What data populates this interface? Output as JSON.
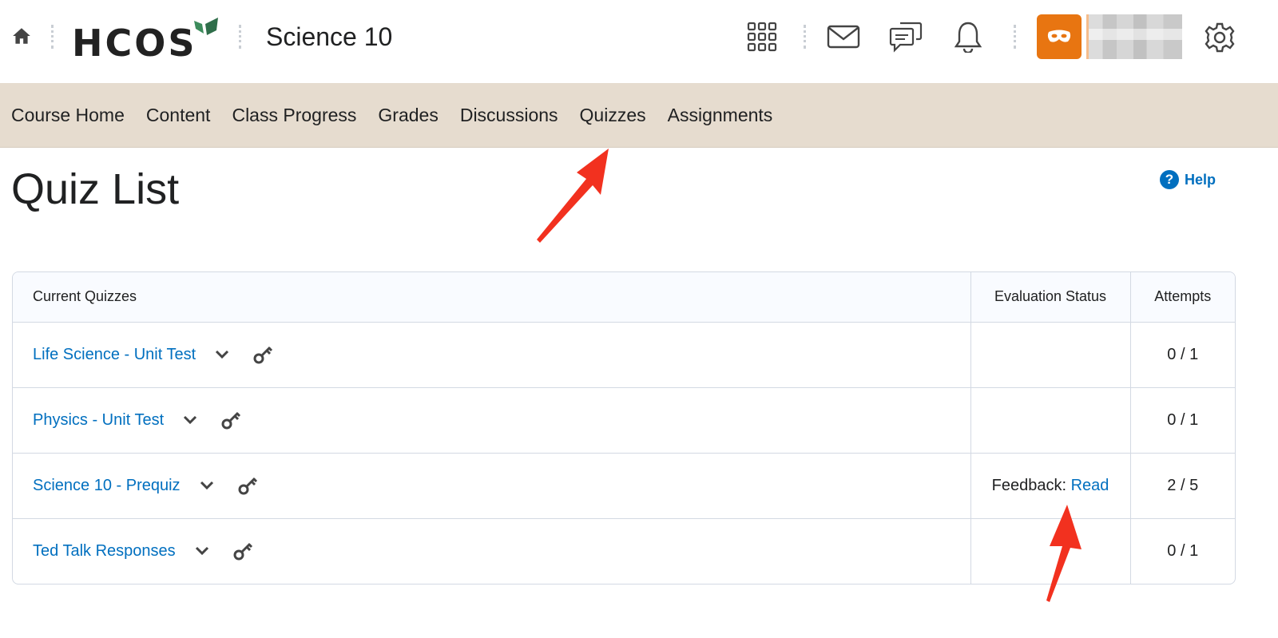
{
  "header": {
    "logo_text": "HCOS",
    "course_title": "Science 10",
    "icons": {
      "home": "home-icon",
      "apps": "grid-icon",
      "mail": "mail-icon",
      "chat": "chat-icon",
      "notifications": "bell-icon",
      "avatar": "mask-icon",
      "settings": "gear-icon"
    },
    "avatar_color": "#e87511"
  },
  "nav": {
    "items": [
      "Course Home",
      "Content",
      "Class Progress",
      "Grades",
      "Discussions",
      "Quizzes",
      "Assignments"
    ],
    "background": "#e6dccf"
  },
  "page": {
    "title": "Quiz List",
    "help_label": "Help"
  },
  "table": {
    "headers": {
      "quiz": "Current Quizzes",
      "evaluation": "Evaluation Status",
      "attempts": "Attempts"
    },
    "rows": [
      {
        "name": "Life Science - Unit Test",
        "evaluation_label": "",
        "evaluation_link": "",
        "attempts": "0 / 1"
      },
      {
        "name": "Physics - Unit Test",
        "evaluation_label": "",
        "evaluation_link": "",
        "attempts": "0 / 1"
      },
      {
        "name": "Science 10 - Prequiz",
        "evaluation_label": "Feedback:",
        "evaluation_link": "Read",
        "attempts": "2 / 5"
      },
      {
        "name": "Ted Talk Responses",
        "evaluation_label": "",
        "evaluation_link": "",
        "attempts": "0 / 1"
      }
    ]
  },
  "colors": {
    "link": "#006fbf",
    "annotation_arrow": "#f2311f"
  }
}
